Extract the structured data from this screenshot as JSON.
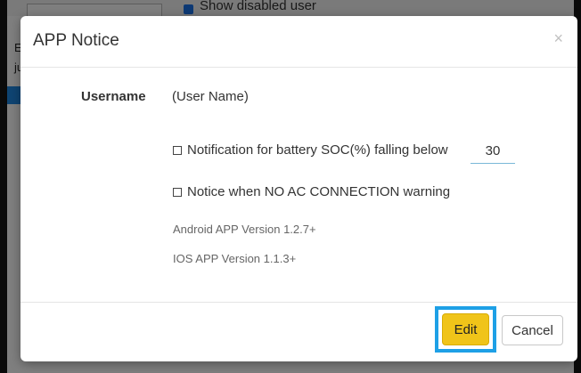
{
  "background": {
    "top_text": "Show disabled user",
    "left_letters": [
      "E",
      "ju"
    ]
  },
  "modal": {
    "title": "APP Notice",
    "close_glyph": "×",
    "username_label": "Username",
    "username_value": "(User Name)",
    "battery_option_label": "Notification for battery SOC(%) falling below",
    "battery_threshold": "30",
    "ac_option_label": "Notice when NO AC CONNECTION warning",
    "android_version": "Android APP Version 1.2.7+",
    "ios_version": "IOS APP Version 1.1.3+",
    "edit_label": "Edit",
    "cancel_label": "Cancel"
  },
  "colors": {
    "edit_button": "#f0c419",
    "highlight_border": "#1ea0e6",
    "background_accent": "#1e88e5"
  }
}
